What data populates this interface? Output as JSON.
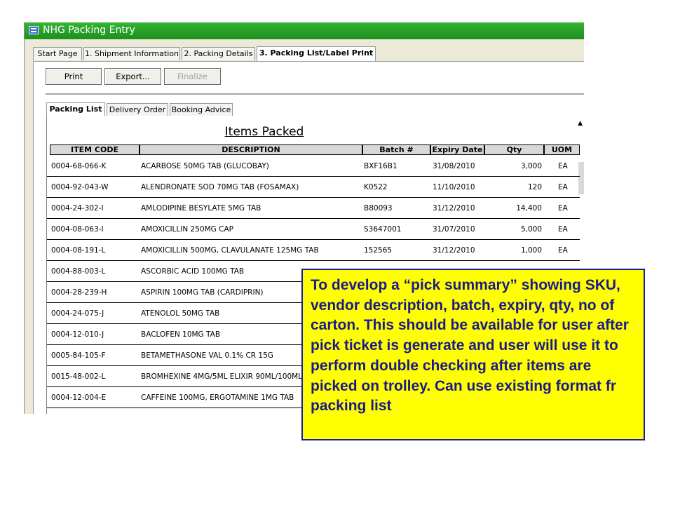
{
  "window": {
    "title": "NHG Packing Entry"
  },
  "tabs": [
    "Start Page",
    "1. Shipment Information",
    "2. Packing Details",
    "3. Packing List/Label Print"
  ],
  "toolbar": {
    "print": "Print",
    "export": "Export...",
    "finalize": "Finalize"
  },
  "subtabs": [
    "Packing List",
    "Delivery Order",
    "Booking Advice"
  ],
  "report": {
    "title": "Items Packed",
    "columns": [
      "ITEM CODE",
      "DESCRIPTION",
      "Batch #",
      "Expiry Date",
      "Qty",
      "UOM"
    ],
    "rows": [
      [
        "0004-68-066-K",
        "ACARBOSE 50MG TAB (GLUCOBAY)",
        "BXF16B1",
        "31/08/2010",
        "3,000",
        "EA"
      ],
      [
        "0004-92-043-W",
        "ALENDRONATE SOD 70MG TAB (FOSAMAX)",
        "K0522",
        "11/10/2010",
        "120",
        "EA"
      ],
      [
        "0004-24-302-I",
        "AMLODIPINE BESYLATE 5MG TAB",
        "B80093",
        "31/12/2010",
        "14,400",
        "EA"
      ],
      [
        "0004-08-063-I",
        "AMOXICILLIN 250MG CAP",
        "S3647001",
        "31/07/2010",
        "5,000",
        "EA"
      ],
      [
        "0004-08-191-L",
        "AMOXICILLIN 500MG, CLAVULANATE 125MG TAB",
        "152565",
        "31/12/2010",
        "1,000",
        "EA"
      ],
      [
        "0004-88-003-L",
        "ASCORBIC ACID 100MG TAB",
        "",
        "",
        "",
        ""
      ],
      [
        "0004-28-239-H",
        "ASPIRIN 100MG TAB (CARDIPRIN)",
        "",
        "",
        "",
        ""
      ],
      [
        "0004-24-075-J",
        "ATENOLOL 50MG TAB",
        "",
        "",
        "",
        ""
      ],
      [
        "0004-12-010-J",
        "BACLOFEN 10MG TAB",
        "",
        "",
        "",
        ""
      ],
      [
        "0005-84-105-F",
        "BETAMETHASONE VAL 0.1% CR 15G",
        "",
        "",
        "",
        ""
      ],
      [
        "0015-48-002-L",
        "BROMHEXINE 4MG/5ML ELIXIR 90ML/100ML",
        "",
        "",
        "",
        ""
      ],
      [
        "0004-12-004-E",
        "CAFFEINE 100MG, ERGOTAMINE 1MG TAB",
        "",
        "",
        "",
        ""
      ]
    ]
  },
  "note": {
    "text": "To develop a “pick summary” showing SKU, vendor description, batch, expiry, qty, no of carton.  This should be available for user after pick ticket is generate and user will use it to perform double checking after items are picked on trolley.  Can use existing format fr packing list"
  },
  "colors": {
    "titlebar": "#24a024",
    "note_bg": "#ffff00",
    "note_text": "#1a1a8e",
    "note_border": "#1a1aa6"
  }
}
